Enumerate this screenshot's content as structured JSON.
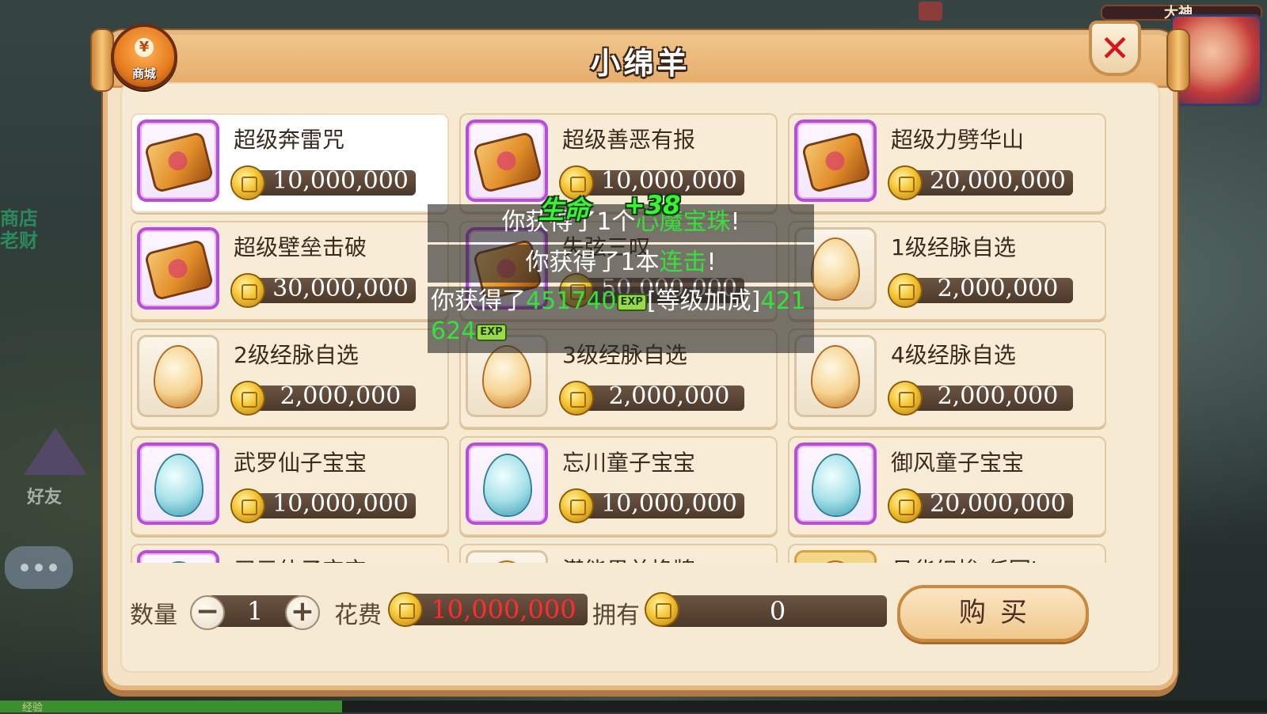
{
  "window": {
    "title": "小绵羊",
    "shop_badge": "商城",
    "close_glyph": "✕"
  },
  "background": {
    "shop_text": "商店",
    "shop_sub": "老财",
    "friend_text": "好友",
    "boss_name": "大神",
    "exp_label": "经验",
    "exp_fill_percent": 27
  },
  "items": [
    {
      "name": "超级奔雷咒",
      "price": "10,000,000",
      "icon": "scroll-icon",
      "frame": "purple",
      "selected": true
    },
    {
      "name": "超级善恶有报",
      "price": "10,000,000",
      "icon": "scroll-icon",
      "frame": "purple",
      "selected": false
    },
    {
      "name": "超级力劈华山",
      "price": "20,000,000",
      "icon": "scroll-icon",
      "frame": "purple",
      "selected": false
    },
    {
      "name": "超级壁垒击破",
      "price": "30,000,000",
      "icon": "scroll-icon",
      "frame": "purple",
      "selected": false
    },
    {
      "name": "失弦三叹",
      "price": "50,000,000",
      "icon": "scroll-icon",
      "frame": "purple",
      "selected": false
    },
    {
      "name": "1级经脉自选",
      "price": "2,000,000",
      "icon": "golden-egg-icon",
      "frame": "plain",
      "selected": false
    },
    {
      "name": "2级经脉自选",
      "price": "2,000,000",
      "icon": "golden-egg-icon",
      "frame": "plain",
      "selected": false
    },
    {
      "name": "3级经脉自选",
      "price": "2,000,000",
      "icon": "golden-egg-icon",
      "frame": "plain",
      "selected": false
    },
    {
      "name": "4级经脉自选",
      "price": "2,000,000",
      "icon": "golden-egg-icon",
      "frame": "plain",
      "selected": false
    },
    {
      "name": "武罗仙子宝宝",
      "price": "10,000,000",
      "icon": "pet-egg-icon",
      "frame": "purple",
      "selected": false
    },
    {
      "name": "忘川童子宝宝",
      "price": "10,000,000",
      "icon": "pet-egg-icon",
      "frame": "purple",
      "selected": false
    },
    {
      "name": "御风童子宝宝",
      "price": "20,000,000",
      "icon": "pet-egg-icon",
      "frame": "purple",
      "selected": false
    },
    {
      "name": "习元仙子宝宝",
      "price": "",
      "icon": "pet-egg-icon",
      "frame": "purple",
      "selected": false
    },
    {
      "name": "潜能果兑换牌",
      "price": "",
      "icon": "card-icon",
      "frame": "plain",
      "selected": false
    },
    {
      "name": "月华织梭·任回h",
      "price": "",
      "icon": "gold-item-icon",
      "frame": "gold",
      "selected": false
    }
  ],
  "messages": {
    "m1_prefix": "你获得了1个",
    "m1_item": "心魔宝珠",
    "m1_suffix": "!",
    "m2_prefix": "你获得了1本",
    "m2_item": "连击",
    "m2_suffix": "!",
    "m3_prefix": "你获得了",
    "m3_exp": "451740",
    "m3_exp_tag": "EXP",
    "m3_bonus_label": "[等级加成]",
    "m3_bonus": "421624",
    "m3_bonus_line1": "421",
    "m3_bonus_line2": "624",
    "float_life": "生命",
    "float_value": "+38"
  },
  "purchase": {
    "quantity_label": "数量",
    "quantity": "1",
    "minus_glyph": "−",
    "plus_glyph": "+",
    "cost_label": "花费",
    "cost": "10,000,000",
    "own_label": "拥有",
    "own": "0",
    "buy_label": "购买"
  },
  "colors": {
    "cost_text": "#ff2d2d",
    "accent_green": "#35e13a",
    "purple_frame": "#b94dd9"
  }
}
